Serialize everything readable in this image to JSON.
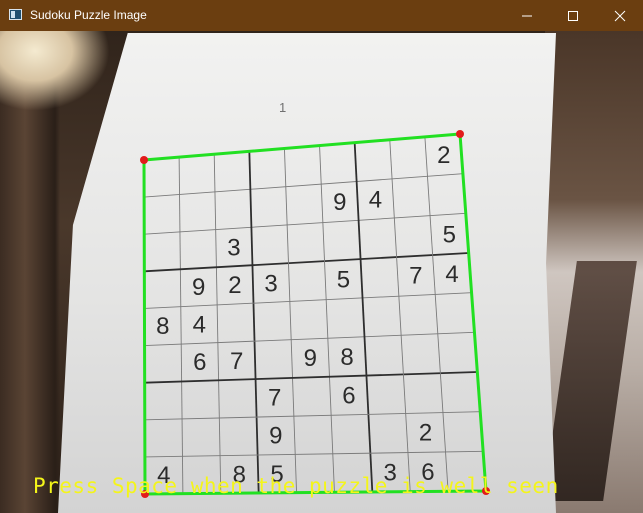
{
  "window": {
    "title": "Sudoku Puzzle Image",
    "controls": [
      "minimize",
      "maximize",
      "close"
    ]
  },
  "page_number": "1",
  "overlay": {
    "prompt": "Press Space when the puzzle is well seen",
    "outline_color": "#22e022",
    "corner_color": "#e21b1b",
    "text_color": "#f4f51a"
  },
  "grid_digits": [
    [
      "",
      "",
      "",
      "",
      "",
      "",
      "",
      "",
      "2"
    ],
    [
      "",
      "",
      "",
      "",
      "",
      "9",
      "4",
      "",
      ""
    ],
    [
      "",
      "",
      "3",
      "",
      "",
      "",
      "",
      "",
      "5"
    ],
    [
      "",
      "9",
      "2",
      "3",
      "",
      "5",
      "",
      "7",
      "4"
    ],
    [
      "8",
      "4",
      "",
      "",
      "",
      "",
      "",
      "",
      ""
    ],
    [
      "",
      "6",
      "7",
      "",
      "9",
      "8",
      "",
      "",
      ""
    ],
    [
      "",
      "",
      "",
      "7",
      "",
      "6",
      "",
      "",
      ""
    ],
    [
      "",
      "",
      "",
      "9",
      "",
      "",
      "",
      "2",
      ""
    ],
    [
      "4",
      "",
      "8",
      "5",
      "",
      "",
      "3",
      "6",
      ""
    ]
  ]
}
